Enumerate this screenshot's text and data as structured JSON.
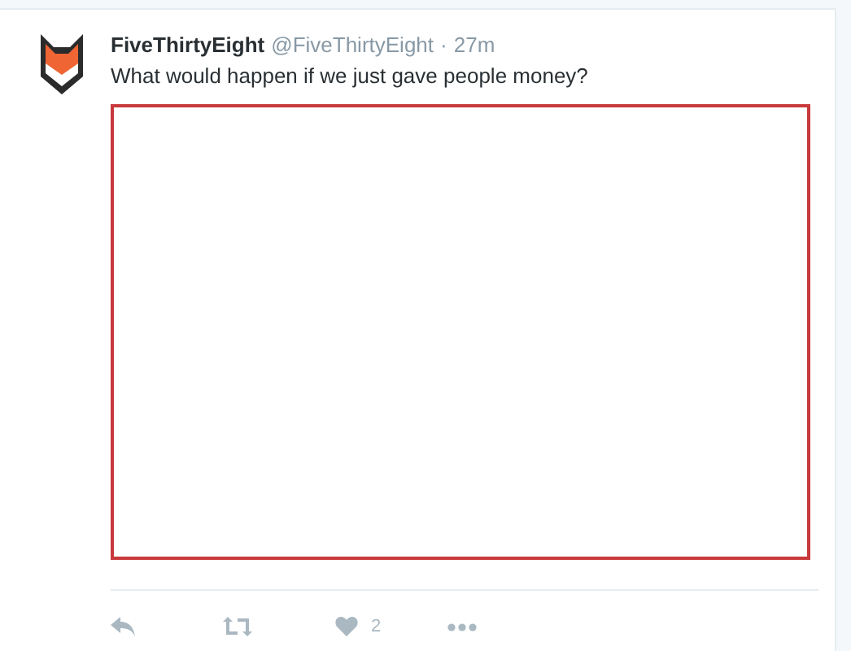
{
  "tweet": {
    "name": "FiveThirtyEight",
    "handle": "@FiveThirtyEight",
    "separator": "·",
    "time": "27m",
    "text": "What would happen if we just gave people money?"
  },
  "actions": {
    "like_count": "2"
  }
}
